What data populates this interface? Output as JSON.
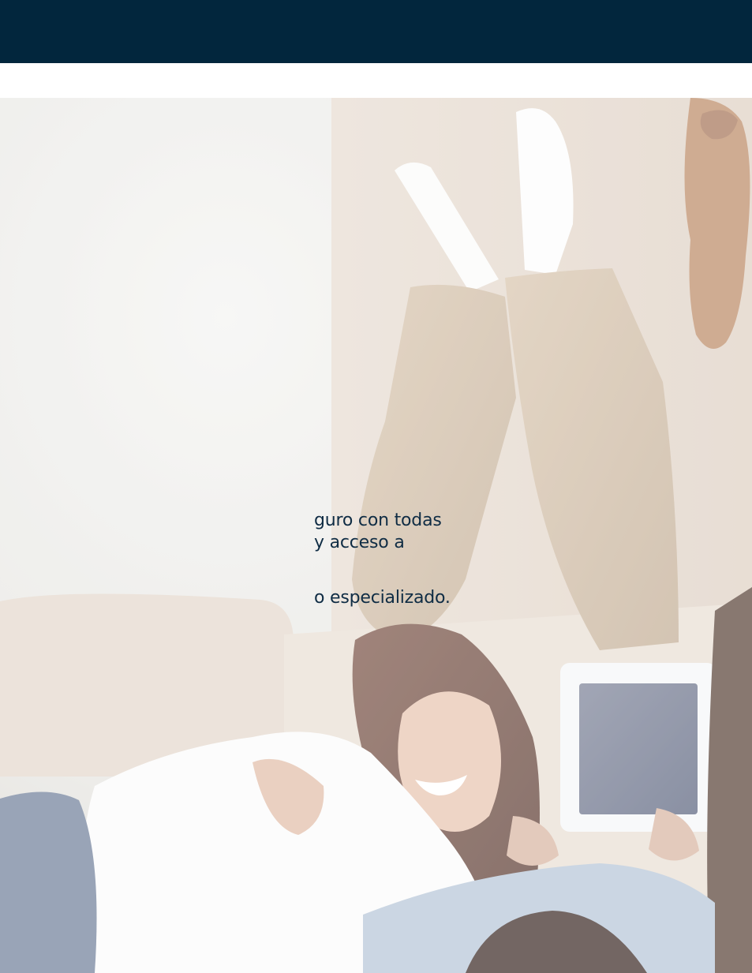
{
  "hero": {
    "text_lines": [
      "guro con todas",
      "y acceso a",
      "o especializado."
    ]
  },
  "colors": {
    "top_bar": "#02263d",
    "text": "#0f2c44",
    "background": "#ffffff"
  }
}
